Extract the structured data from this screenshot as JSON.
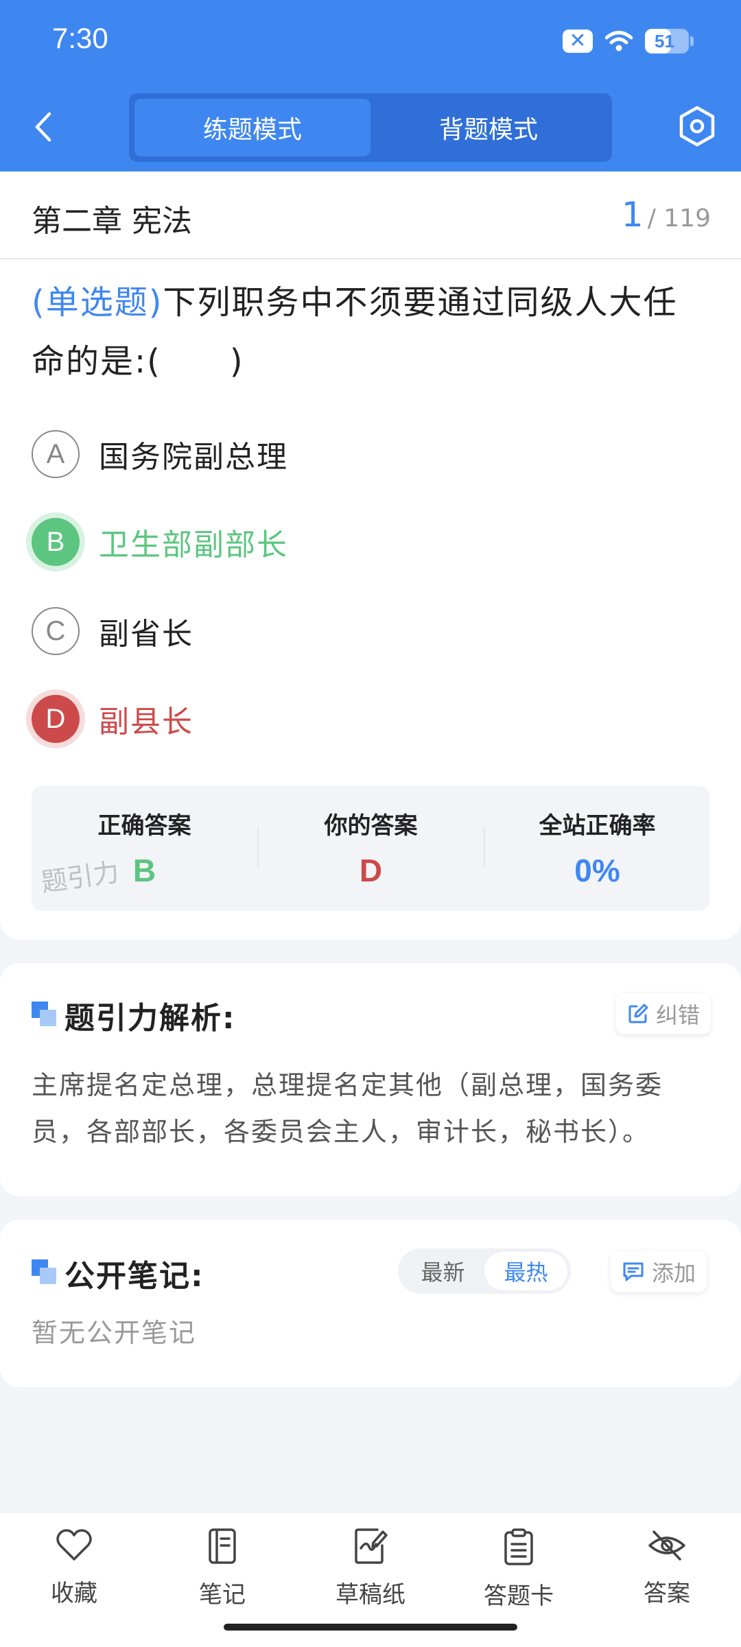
{
  "status_bar": {
    "time": "7:30",
    "notif_icon": "close-x-icon",
    "battery": "51"
  },
  "header": {
    "tabs": [
      {
        "label": "练题模式",
        "active": true
      },
      {
        "label": "背题模式",
        "active": false
      }
    ]
  },
  "chapter": {
    "title": "第二章 宪法",
    "current": "1",
    "total": "/ 119"
  },
  "question": {
    "type": "(单选题)",
    "text": "下列职务中不须要通过同级人大任命的是:(　　)",
    "options": [
      {
        "letter": "A",
        "text": "国务院副总理",
        "state": "normal"
      },
      {
        "letter": "B",
        "text": "卫生部副部长",
        "state": "correct"
      },
      {
        "letter": "C",
        "text": "副省长",
        "state": "normal"
      },
      {
        "letter": "D",
        "text": "副县长",
        "state": "wrong"
      }
    ]
  },
  "answer_summary": {
    "correct_label": "正确答案",
    "correct_value": "B",
    "yours_label": "你的答案",
    "yours_value": "D",
    "rate_label": "全站正确率",
    "rate_value": "0%",
    "watermark": "题引力"
  },
  "analysis": {
    "title": "题引力解析:",
    "report_label": "纠错",
    "text": "主席提名定总理，总理提名定其他（副总理，国务委员，各部部长，各委员会主人，审计长，秘书长）。"
  },
  "notes": {
    "title": "公开笔记:",
    "sort": [
      {
        "label": "最新",
        "active": false
      },
      {
        "label": "最热",
        "active": true
      }
    ],
    "add_label": "添加",
    "empty_text": "暂无公开笔记"
  },
  "bottom_nav": [
    {
      "label": "收藏",
      "icon": "heart-icon"
    },
    {
      "label": "笔记",
      "icon": "notebook-icon"
    },
    {
      "label": "草稿纸",
      "icon": "draft-paper-icon"
    },
    {
      "label": "答题卡",
      "icon": "answer-sheet-icon"
    },
    {
      "label": "答案",
      "icon": "eye-off-icon"
    }
  ],
  "colors": {
    "primary": "#3f87f0",
    "correct": "#5cc57f",
    "wrong": "#cd4a4a"
  }
}
